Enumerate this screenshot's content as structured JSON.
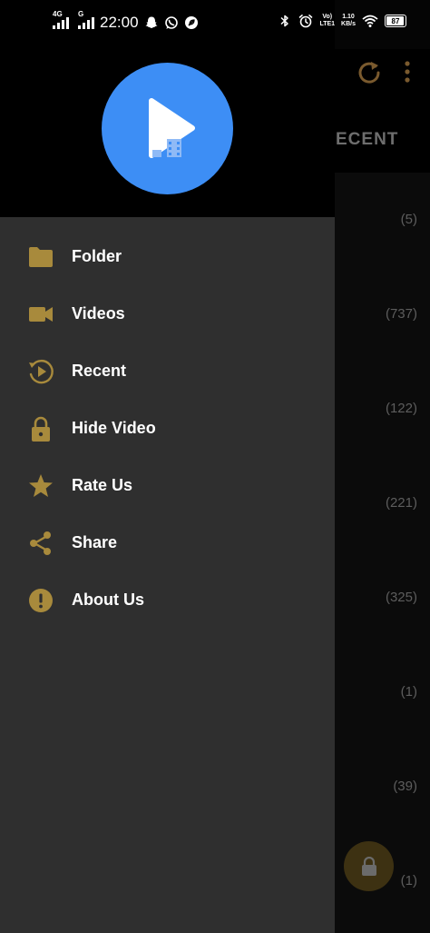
{
  "status_bar": {
    "net1": "4G",
    "net2": "G",
    "time": "22:00",
    "volte_top": "Vo)",
    "volte_bottom": "LTE1",
    "speed_top": "1.10",
    "speed_bottom": "KB/s",
    "battery": "87",
    "battery_level": 0.87
  },
  "background": {
    "tab_label": "ECENT",
    "counts": [
      "(5)",
      "(737)",
      "(122)",
      "(221)",
      "(325)",
      "(1)",
      "(39)",
      "(1)"
    ]
  },
  "drawer": {
    "menu": [
      {
        "label": "Folder",
        "icon": "folder-icon"
      },
      {
        "label": "Videos",
        "icon": "video-camera-icon"
      },
      {
        "label": "Recent",
        "icon": "recent-play-icon"
      },
      {
        "label": "Hide Video",
        "icon": "lock-icon"
      },
      {
        "label": "Rate Us",
        "icon": "star-icon"
      },
      {
        "label": "Share",
        "icon": "share-icon"
      },
      {
        "label": "About Us",
        "icon": "info-icon"
      }
    ]
  },
  "colors": {
    "accent": "#a88a3c",
    "logo_blue": "#3d8ef5",
    "drawer_bg": "#2f2f2f"
  }
}
